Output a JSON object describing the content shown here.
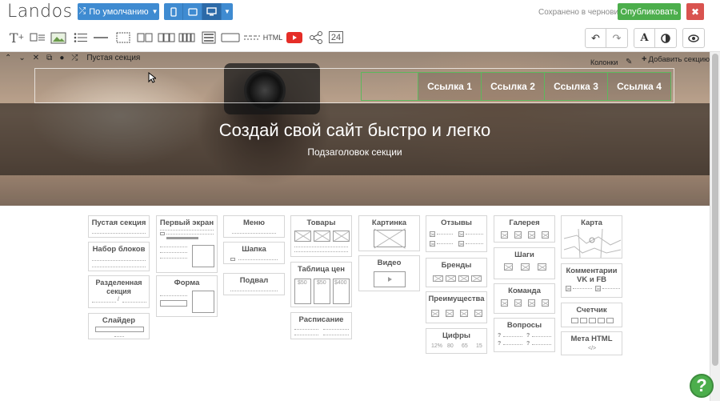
{
  "app": {
    "logo": "Landos",
    "preset_label": "По умолчанию",
    "saved_status": "Сохранено в черновике",
    "publish_label": "Опубликовать",
    "close_symbol": "✖"
  },
  "toolbar": {
    "html_label": "HTML",
    "counter_label": "24",
    "font_label": "A"
  },
  "section": {
    "label": "Пустая секция",
    "columns_label": "Колонки",
    "add_section_label": "Добавить секцию",
    "nav_links": [
      "Ссылка 1",
      "Ссылка 2",
      "Ссылка 3",
      "Ссылка 4"
    ],
    "title": "Создай свой сайт быстро и легко",
    "subtitle": "Подзаголовок секции"
  },
  "blocks": {
    "empty": "Пустая секция",
    "set": "Набор блоков",
    "divided": "Разделенная секция",
    "slider": "Слайдер",
    "first_screen": "Первый экран",
    "form": "Форма",
    "menu": "Меню",
    "header": "Шапка",
    "footer": "Подвал",
    "goods": "Товары",
    "price_table": "Таблица цен",
    "schedule": "Расписание",
    "picture": "Картинка",
    "video": "Видео",
    "reviews": "Отзывы",
    "brands": "Бренды",
    "advantages": "Преимущества",
    "figures": "Цифры",
    "gallery": "Галерея",
    "steps": "Шаги",
    "team": "Команда",
    "questions": "Вопросы",
    "map": "Карта",
    "comments": "Комментарии VK и FB",
    "counter": "Счетчик",
    "meta": "Мета HTML"
  },
  "block_wire_text": {
    "price_cols": [
      "$50",
      "$50",
      "$400"
    ],
    "figures_nums": [
      "12%",
      "80",
      "65",
      "15"
    ],
    "meta_code": "</>"
  },
  "help_symbol": "?"
}
